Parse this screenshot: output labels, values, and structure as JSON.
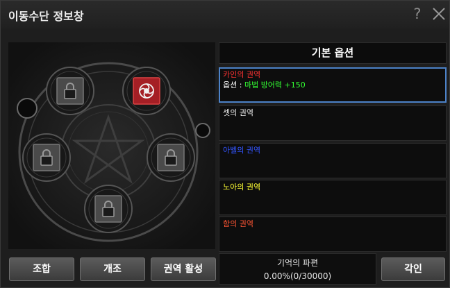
{
  "window": {
    "title": "이동수단 정보창",
    "help_label": "?"
  },
  "option_panel": {
    "header": "기본 옵션",
    "domains": [
      {
        "name": "카인의 권역",
        "name_color": "#ff3333",
        "selected": true,
        "option_prefix": "옵션 : ",
        "option_value": "마법 방어력 +150",
        "option_color": "#33ff33"
      },
      {
        "name": "셋의 권역",
        "name_color": "#f0f0f0",
        "selected": false
      },
      {
        "name": "아벨의 권역",
        "name_color": "#3355ff",
        "selected": false
      },
      {
        "name": "노아의 권역",
        "name_color": "#ffff33",
        "selected": false
      },
      {
        "name": "함의 권역",
        "name_color": "#ff5533",
        "selected": false
      }
    ]
  },
  "slots": [
    {
      "name": "slot-top-left",
      "state": "locked"
    },
    {
      "name": "slot-top-right",
      "state": "active"
    },
    {
      "name": "slot-middle-left",
      "state": "locked"
    },
    {
      "name": "slot-middle-right",
      "state": "locked"
    },
    {
      "name": "slot-bottom",
      "state": "locked"
    }
  ],
  "buttons": {
    "combine": "조합",
    "modify": "개조",
    "activate": "권역 활성",
    "engrave": "각인"
  },
  "memory": {
    "label": "기억의 파편",
    "value": "0.00%(0/30000)"
  },
  "icons": {
    "help": "help-icon",
    "close": "close-icon",
    "lock": "lock-icon",
    "rose": "rose-emblem-icon"
  },
  "colors": {
    "selected_border": "#4c82c8",
    "active_slot": "#c0272d"
  }
}
